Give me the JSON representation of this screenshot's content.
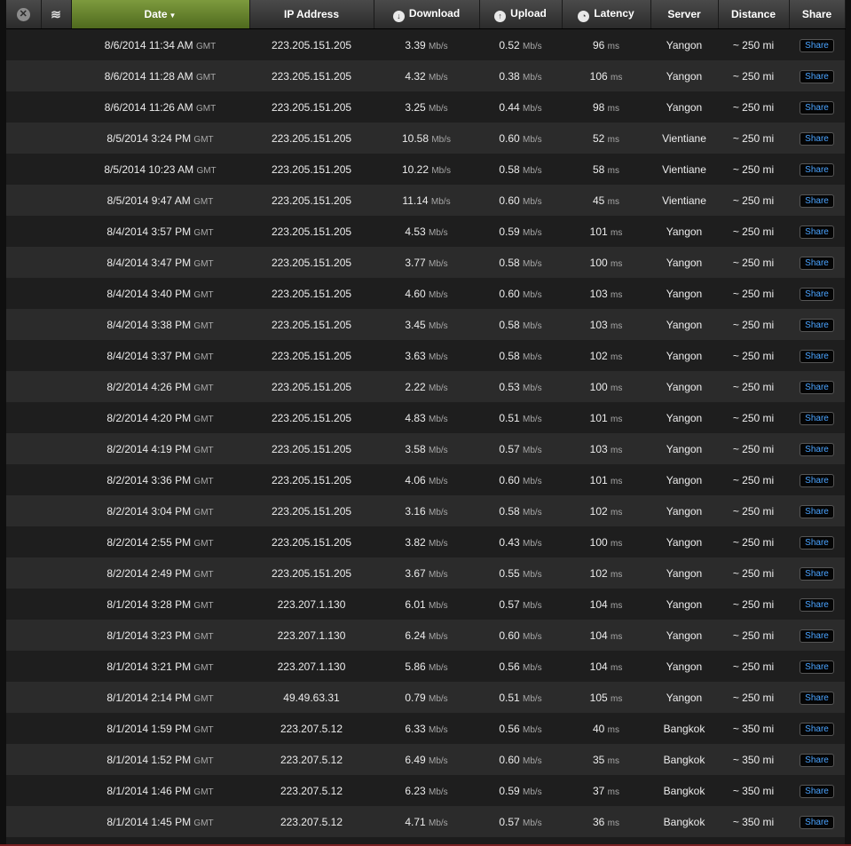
{
  "header": {
    "close_glyph": "✕",
    "stack_glyph": "≋",
    "date": "Date",
    "sort_arrow": "▼",
    "ip": "IP Address",
    "download": "Download",
    "upload": "Upload",
    "latency": "Latency",
    "server": "Server",
    "distance": "Distance",
    "share": "Share"
  },
  "units": {
    "speed": "Mb/s",
    "latency": "ms",
    "tz": "GMT"
  },
  "rows": [
    {
      "date": "8/6/2014 11:34 AM",
      "ip": "223.205.151.205",
      "download": "3.39",
      "upload": "0.52",
      "latency": "96",
      "server": "Yangon",
      "distance": "~ 250 mi",
      "share": "Share"
    },
    {
      "date": "8/6/2014 11:28 AM",
      "ip": "223.205.151.205",
      "download": "4.32",
      "upload": "0.38",
      "latency": "106",
      "server": "Yangon",
      "distance": "~ 250 mi",
      "share": "Share"
    },
    {
      "date": "8/6/2014 11:26 AM",
      "ip": "223.205.151.205",
      "download": "3.25",
      "upload": "0.44",
      "latency": "98",
      "server": "Yangon",
      "distance": "~ 250 mi",
      "share": "Share"
    },
    {
      "date": "8/5/2014 3:24 PM",
      "ip": "223.205.151.205",
      "download": "10.58",
      "upload": "0.60",
      "latency": "52",
      "server": "Vientiane",
      "distance": "~ 250 mi",
      "share": "Share"
    },
    {
      "date": "8/5/2014 10:23 AM",
      "ip": "223.205.151.205",
      "download": "10.22",
      "upload": "0.58",
      "latency": "58",
      "server": "Vientiane",
      "distance": "~ 250 mi",
      "share": "Share"
    },
    {
      "date": "8/5/2014 9:47 AM",
      "ip": "223.205.151.205",
      "download": "11.14",
      "upload": "0.60",
      "latency": "45",
      "server": "Vientiane",
      "distance": "~ 250 mi",
      "share": "Share"
    },
    {
      "date": "8/4/2014 3:57 PM",
      "ip": "223.205.151.205",
      "download": "4.53",
      "upload": "0.59",
      "latency": "101",
      "server": "Yangon",
      "distance": "~ 250 mi",
      "share": "Share"
    },
    {
      "date": "8/4/2014 3:47 PM",
      "ip": "223.205.151.205",
      "download": "3.77",
      "upload": "0.58",
      "latency": "100",
      "server": "Yangon",
      "distance": "~ 250 mi",
      "share": "Share"
    },
    {
      "date": "8/4/2014 3:40 PM",
      "ip": "223.205.151.205",
      "download": "4.60",
      "upload": "0.60",
      "latency": "103",
      "server": "Yangon",
      "distance": "~ 250 mi",
      "share": "Share"
    },
    {
      "date": "8/4/2014 3:38 PM",
      "ip": "223.205.151.205",
      "download": "3.45",
      "upload": "0.58",
      "latency": "103",
      "server": "Yangon",
      "distance": "~ 250 mi",
      "share": "Share"
    },
    {
      "date": "8/4/2014 3:37 PM",
      "ip": "223.205.151.205",
      "download": "3.63",
      "upload": "0.58",
      "latency": "102",
      "server": "Yangon",
      "distance": "~ 250 mi",
      "share": "Share"
    },
    {
      "date": "8/2/2014 4:26 PM",
      "ip": "223.205.151.205",
      "download": "2.22",
      "upload": "0.53",
      "latency": "100",
      "server": "Yangon",
      "distance": "~ 250 mi",
      "share": "Share"
    },
    {
      "date": "8/2/2014 4:20 PM",
      "ip": "223.205.151.205",
      "download": "4.83",
      "upload": "0.51",
      "latency": "101",
      "server": "Yangon",
      "distance": "~ 250 mi",
      "share": "Share"
    },
    {
      "date": "8/2/2014 4:19 PM",
      "ip": "223.205.151.205",
      "download": "3.58",
      "upload": "0.57",
      "latency": "103",
      "server": "Yangon",
      "distance": "~ 250 mi",
      "share": "Share"
    },
    {
      "date": "8/2/2014 3:36 PM",
      "ip": "223.205.151.205",
      "download": "4.06",
      "upload": "0.60",
      "latency": "101",
      "server": "Yangon",
      "distance": "~ 250 mi",
      "share": "Share"
    },
    {
      "date": "8/2/2014 3:04 PM",
      "ip": "223.205.151.205",
      "download": "3.16",
      "upload": "0.58",
      "latency": "102",
      "server": "Yangon",
      "distance": "~ 250 mi",
      "share": "Share"
    },
    {
      "date": "8/2/2014 2:55 PM",
      "ip": "223.205.151.205",
      "download": "3.82",
      "upload": "0.43",
      "latency": "100",
      "server": "Yangon",
      "distance": "~ 250 mi",
      "share": "Share"
    },
    {
      "date": "8/2/2014 2:49 PM",
      "ip": "223.205.151.205",
      "download": "3.67",
      "upload": "0.55",
      "latency": "102",
      "server": "Yangon",
      "distance": "~ 250 mi",
      "share": "Share"
    },
    {
      "date": "8/1/2014 3:28 PM",
      "ip": "223.207.1.130",
      "download": "6.01",
      "upload": "0.57",
      "latency": "104",
      "server": "Yangon",
      "distance": "~ 250 mi",
      "share": "Share"
    },
    {
      "date": "8/1/2014 3:23 PM",
      "ip": "223.207.1.130",
      "download": "6.24",
      "upload": "0.60",
      "latency": "104",
      "server": "Yangon",
      "distance": "~ 250 mi",
      "share": "Share"
    },
    {
      "date": "8/1/2014 3:21 PM",
      "ip": "223.207.1.130",
      "download": "5.86",
      "upload": "0.56",
      "latency": "104",
      "server": "Yangon",
      "distance": "~ 250 mi",
      "share": "Share"
    },
    {
      "date": "8/1/2014 2:14 PM",
      "ip": "49.49.63.31",
      "download": "0.79",
      "upload": "0.51",
      "latency": "105",
      "server": "Yangon",
      "distance": "~ 250 mi",
      "share": "Share"
    },
    {
      "date": "8/1/2014 1:59 PM",
      "ip": "223.207.5.12",
      "download": "6.33",
      "upload": "0.56",
      "latency": "40",
      "server": "Bangkok",
      "distance": "~ 350 mi",
      "share": "Share"
    },
    {
      "date": "8/1/2014 1:52 PM",
      "ip": "223.207.5.12",
      "download": "6.49",
      "upload": "0.60",
      "latency": "35",
      "server": "Bangkok",
      "distance": "~ 350 mi",
      "share": "Share"
    },
    {
      "date": "8/1/2014 1:46 PM",
      "ip": "223.207.5.12",
      "download": "6.23",
      "upload": "0.59",
      "latency": "37",
      "server": "Bangkok",
      "distance": "~ 350 mi",
      "share": "Share"
    },
    {
      "date": "8/1/2014 1:45 PM",
      "ip": "223.207.5.12",
      "download": "4.71",
      "upload": "0.57",
      "latency": "36",
      "server": "Bangkok",
      "distance": "~ 350 mi",
      "share": "Share"
    }
  ]
}
